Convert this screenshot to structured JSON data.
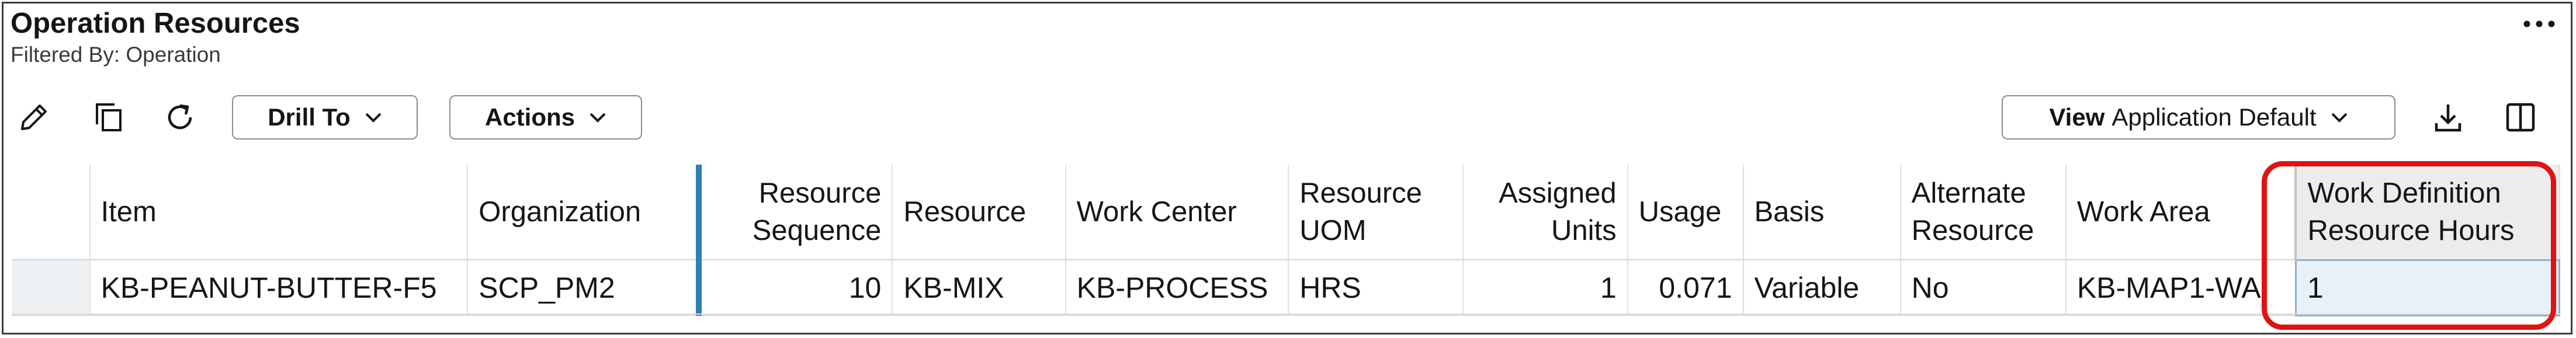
{
  "panel": {
    "title": "Operation Resources",
    "subtitle": "Filtered By: Operation",
    "more_icon": "more-horizontal-icon"
  },
  "toolbar": {
    "edit_icon": "pencil-icon",
    "duplicate_icon": "copy-icon",
    "refresh_icon": "refresh-icon",
    "drill_to_label": "Drill To",
    "actions_label": "Actions",
    "view_label": "View",
    "view_value": "Application Default",
    "download_icon": "download-icon",
    "columns_icon": "split-columns-icon"
  },
  "table": {
    "headers": {
      "item": "Item",
      "organization": "Organization",
      "resource_sequence_1": "Resource",
      "resource_sequence_2": "Sequence",
      "resource": "Resource",
      "work_center": "Work Center",
      "resource_uom_1": "Resource",
      "resource_uom_2": "UOM",
      "assigned_units_1": "Assigned",
      "assigned_units_2": "Units",
      "usage": "Usage",
      "basis": "Basis",
      "alternate_resource_1": "Alternate",
      "alternate_resource_2": "Resource",
      "work_area": "Work Area",
      "work_definition_resource_hours_1": "Work Definition",
      "work_definition_resource_hours_2": "Resource Hours"
    },
    "rows": [
      {
        "item": "KB-PEANUT-BUTTER-F5",
        "organization": "SCP_PM2",
        "resource_sequence": "10",
        "resource": "KB-MIX",
        "work_center": "KB-PROCESS",
        "resource_uom": "HRS",
        "assigned_units": "1",
        "usage": "0.071",
        "basis": "Variable",
        "alternate_resource": "No",
        "work_area": "KB-MAP1-WA",
        "work_definition_resource_hours": "1"
      }
    ]
  },
  "colors": {
    "frozen_column_divider": "#2f7fb3",
    "highlight_ring": "#e11212",
    "selected_cell_fill": "#e8f1f8"
  }
}
